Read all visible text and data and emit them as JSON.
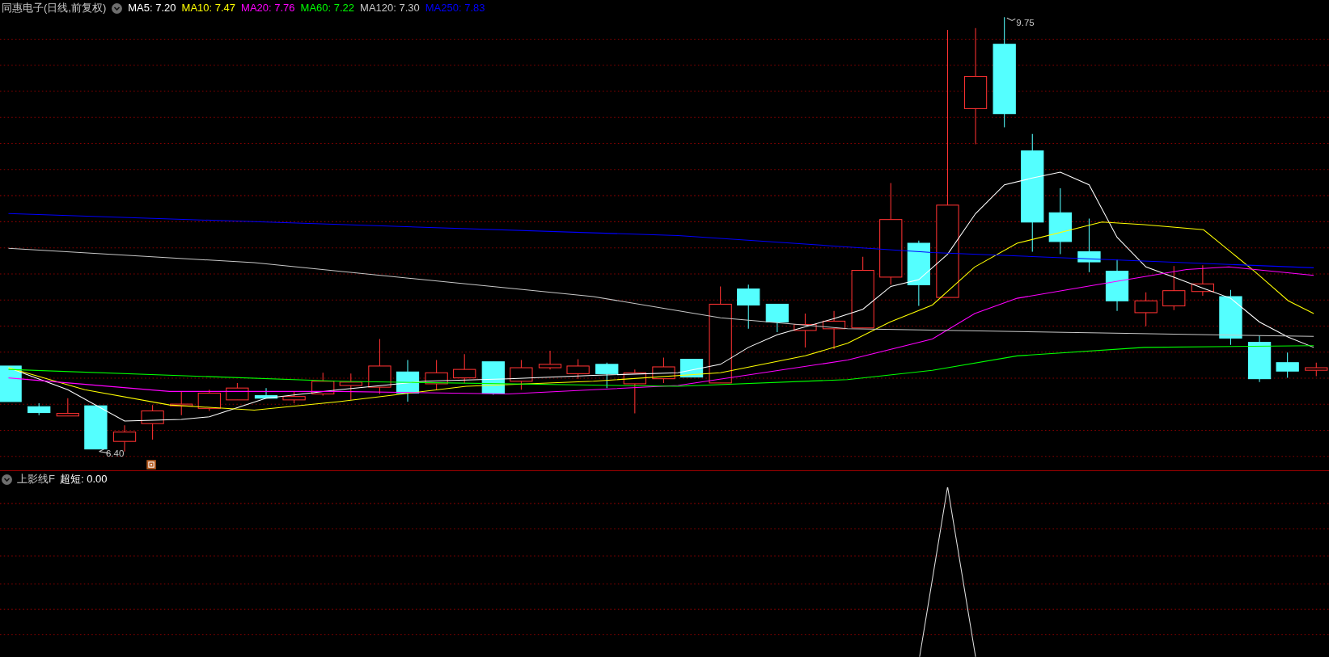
{
  "title": "同惠电子(日线,前复权)",
  "ma_legend": [
    {
      "label": "MA5: 7.20",
      "color": "#ffffff"
    },
    {
      "label": "MA10: 7.47",
      "color": "#ffff00"
    },
    {
      "label": "MA20: 7.76",
      "color": "#ff00ff"
    },
    {
      "label": "MA60: 7.22",
      "color": "#00ff00"
    },
    {
      "label": "MA120: 7.30",
      "color": "#c8c8c8"
    },
    {
      "label": "MA250: 7.83",
      "color": "#0000ff"
    }
  ],
  "price_marks": [
    {
      "kind": "high",
      "label": "9.75"
    },
    {
      "kind": "low",
      "label": "6.40"
    }
  ],
  "indicator": {
    "name": "上影线F",
    "reading": "超短: 0.00"
  }
}
